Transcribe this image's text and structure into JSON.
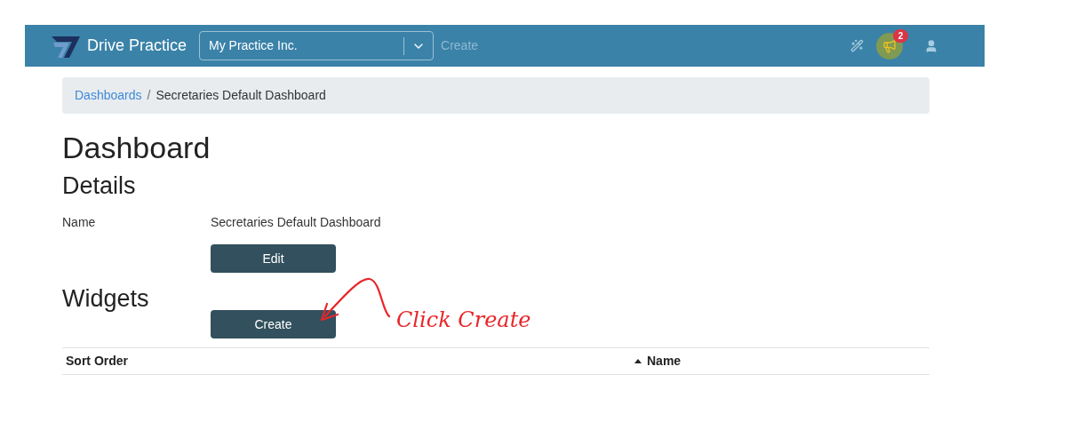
{
  "navbar": {
    "brand": "Drive Practice",
    "org_select": {
      "value": "My Practice Inc."
    },
    "create_link": "Create",
    "notifications": {
      "badge": "2",
      "highlighted": true
    }
  },
  "breadcrumb": [
    {
      "label": "Dashboards",
      "link": true
    },
    {
      "label": "Secretaries Default Dashboard",
      "link": false
    }
  ],
  "breadcrumb_separator": "/",
  "title": "Dashboard",
  "details": {
    "heading": "Details",
    "fields": [
      {
        "label": "Name",
        "value": "Secretaries Default Dashboard"
      }
    ],
    "button": "Edit"
  },
  "widgets": {
    "heading": "Widgets",
    "button": "Create",
    "columns": [
      {
        "label": "Sort Order",
        "sorted": false
      },
      {
        "label": "Name",
        "sorted": true
      }
    ]
  },
  "annotation": {
    "text": "Click Create"
  }
}
